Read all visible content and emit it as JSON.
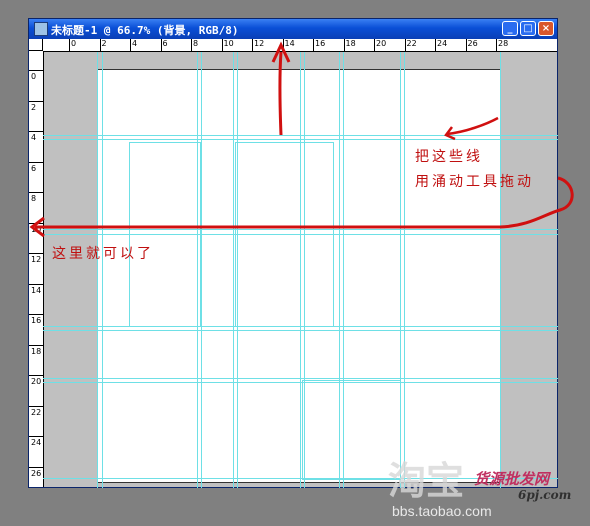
{
  "window": {
    "title": "未标题-1 @ 66.7% (背景, RGB/8)",
    "zoom": "66.7%",
    "minimize_label": "_",
    "maximize_label": "□",
    "close_label": "×"
  },
  "ruler": {
    "top_labels": [
      "0",
      "2",
      "4",
      "6",
      "8",
      "10",
      "12",
      "14",
      "16",
      "18",
      "20",
      "22",
      "24",
      "26",
      "28"
    ],
    "left_labels": [
      "0",
      "2",
      "4",
      "6",
      "8",
      "10",
      "12",
      "14",
      "16",
      "18",
      "20",
      "22",
      "24",
      "26"
    ]
  },
  "annotations": {
    "line1": "把这些线",
    "line2": "用涌动工具拖动",
    "here": "这里就可以了"
  },
  "watermark": {
    "left": "淘宝",
    "right": "货源批发网",
    "site": "6pj.com",
    "url": "bbs.taobao.com"
  },
  "colors": {
    "guide": "#6ee0e6",
    "annotation": "#c01010",
    "title_bar": "#0a4fd6"
  }
}
